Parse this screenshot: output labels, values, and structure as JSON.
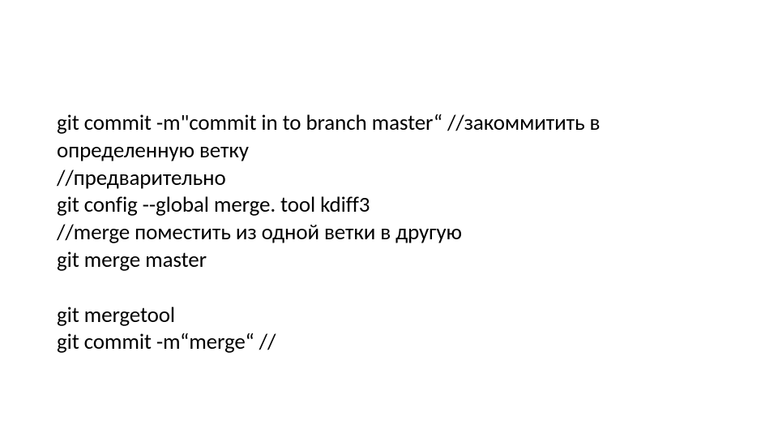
{
  "lines": {
    "l1": "git commit -m\"commit in to branch master“  //закоммитить в определенную ветку",
    "l2": "//предварительно",
    "l3": "git config --global merge. tool kdiff3",
    "l4": "//merge поместить из одной ветки в другую",
    "l5": "git merge master",
    "l6": "git mergetool",
    "l7": "git commit -m“merge“  //"
  }
}
